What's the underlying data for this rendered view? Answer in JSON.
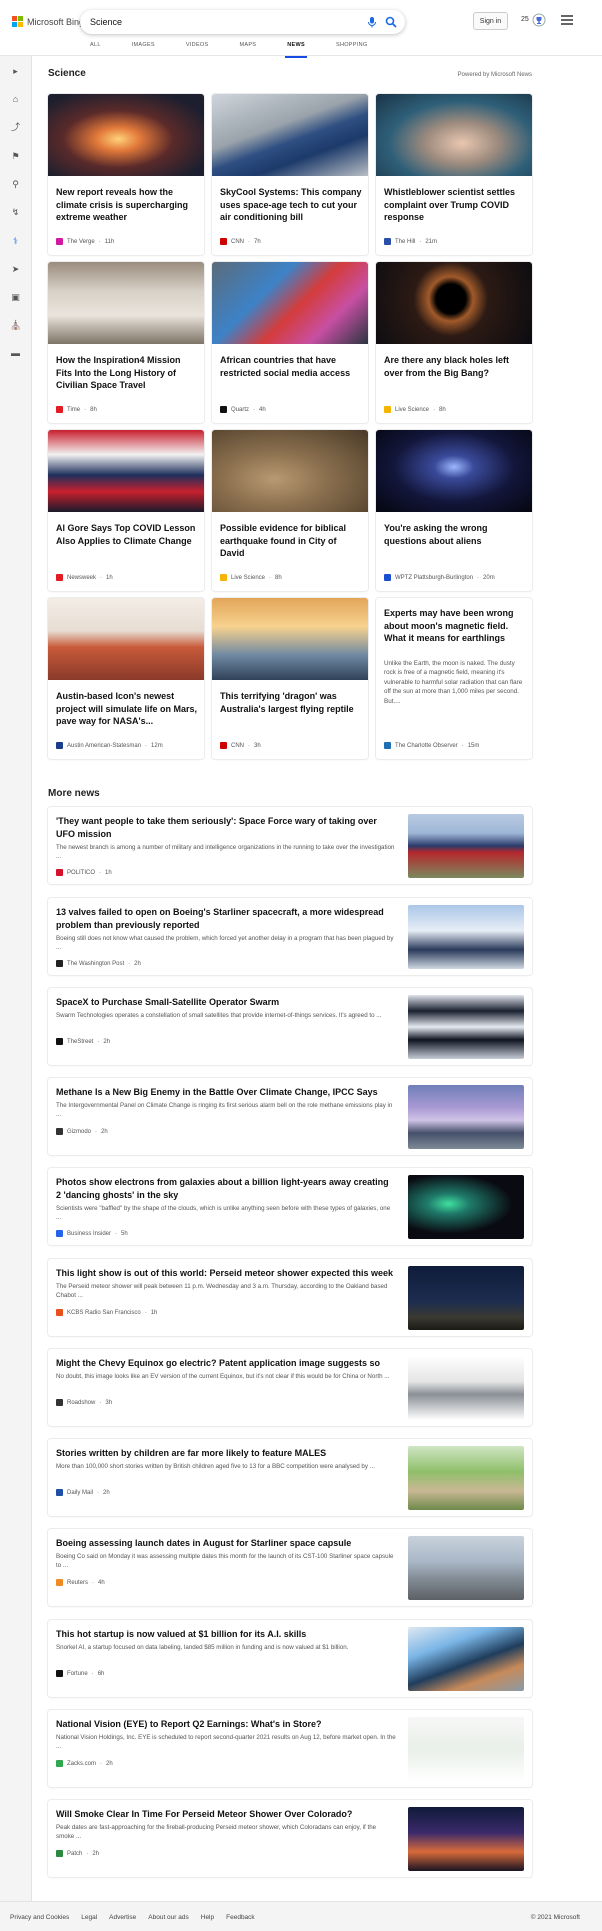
{
  "header": {
    "brand": "Microsoft Bing",
    "search_value": "Science",
    "signin": "Sign in",
    "points": "25",
    "tabs": [
      "ALL",
      "IMAGES",
      "VIDEOS",
      "MAPS",
      "NEWS",
      "SHOPPING"
    ],
    "active_tab": "NEWS"
  },
  "rail_icons": [
    "chevron-right-icon",
    "home-icon",
    "share-icon",
    "flag-icon",
    "location-icon",
    "science-icon",
    "rocket-icon",
    "film-icon",
    "bank-icon",
    "card-icon",
    "user-icon"
  ],
  "section": {
    "title": "Science",
    "powered": "Powered by Microsoft News"
  },
  "cards": [
    {
      "title": "New report reveals how the climate crisis is supercharging extreme weather",
      "source": "The Verge",
      "time": "11h",
      "fav": "#d11aa0"
    },
    {
      "title": "SkyCool Systems: This company uses space-age tech to cut your air conditioning bill",
      "source": "CNN",
      "time": "7h",
      "fav": "#cc0000"
    },
    {
      "title": "Whistleblower scientist settles complaint over Trump COVID response",
      "source": "The Hill",
      "time": "21m",
      "fav": "#2a4fa8"
    },
    {
      "title": "How the Inspiration4 Mission Fits Into the Long History of Civilian Space Travel",
      "source": "Time",
      "time": "8h",
      "fav": "#e31c23"
    },
    {
      "title": "African countries that have restricted social media access",
      "source": "Quartz",
      "time": "4h",
      "fav": "#111111"
    },
    {
      "title": "Are there any black holes left over from the Big Bang?",
      "source": "Live Science",
      "time": "8h",
      "fav": "#f4b400"
    },
    {
      "title": "Al Gore Says Top COVID Lesson Also Applies to Climate Change",
      "source": "Newsweek",
      "time": "1h",
      "fav": "#e31c23"
    },
    {
      "title": "Possible evidence for biblical earthquake found in City of David",
      "source": "Live Science",
      "time": "8h",
      "fav": "#f4b400"
    },
    {
      "title": "You're asking the wrong questions about aliens",
      "source": "WPTZ Plattsburgh-Burlington",
      "time": "20m",
      "fav": "#1a4fd1"
    },
    {
      "title": "Austin-based Icon's newest project will simulate life on Mars, pave way for NASA's...",
      "source": "Austin American-Statesman",
      "time": "12m",
      "fav": "#1a3e8c"
    },
    {
      "title": "This terrifying 'dragon' was Australia's largest flying reptile",
      "source": "CNN",
      "time": "3h",
      "fav": "#cc0000"
    },
    {
      "title": "Experts may have been wrong about moon's magnetic field. What it means for earthlings",
      "snippet": "Unlike the Earth, the moon is naked. The dusty rock is free of a magnetic field, meaning it's vulnerable to harmful solar radiation that can flare off the sun at more than 1,000 miles per second. But....",
      "source": "The Charlotte Observer",
      "time": "15m",
      "fav": "#1f6fb5"
    }
  ],
  "more_news_title": "More news",
  "more_news": [
    {
      "title": "'They want people to take them seriously': Space Force wary of taking over UFO mission",
      "snippet": "The newest branch is among a number of military and intelligence organizations in the running to take over the investigation ...",
      "source": "POLITICO",
      "time": "1h",
      "fav": "#d6112b"
    },
    {
      "title": "13 valves failed to open on Boeing's Starliner spacecraft, a more widespread problem than previously reported",
      "snippet": "Boeing still does not know what caused the problem, which forced yet another delay in a program that has been plagued by ...",
      "source": "The Washington Post",
      "time": "2h",
      "fav": "#222222"
    },
    {
      "title": "SpaceX to Purchase Small-Satellite Operator Swarm",
      "snippet": "Swarm Technologies operates a constellation of small satellites that provide internet-of-things services. It's agreed to ...",
      "source": "TheStreet",
      "time": "2h",
      "fav": "#111111"
    },
    {
      "title": "Methane Is a New Big Enemy in the Battle Over Climate Change, IPCC Says",
      "snippet": "The Intergovernmental Panel on Climate Change is ringing its first serious alarm bell on the role methane emissions play in ...",
      "source": "Gizmodo",
      "time": "2h",
      "fav": "#333333"
    },
    {
      "title": "Photos show electrons from galaxies about a billion light-years away creating 2 'dancing ghosts' in the sky",
      "snippet": "Scientists were \"baffled\" by the shape of the clouds, which is unlike anything seen before with these types of galaxies, one ...",
      "source": "Business Insider",
      "time": "5h",
      "fav": "#2563eb"
    },
    {
      "title": "This light show is out of this world: Perseid meteor shower expected this week",
      "snippet": "The Perseid meteor shower will peak between 11 p.m. Wednesday and 3 a.m. Thursday, according to the Oakland based Chabot ...",
      "source": "KCBS Radio San Francisco",
      "time": "1h",
      "fav": "#e8501c"
    },
    {
      "title": "Might the Chevy Equinox go electric? Patent application image suggests so",
      "snippet": "No doubt, this image looks like an EV version of the current Equinox, but it's not clear if this would be for China or North ...",
      "source": "Roadshow",
      "time": "3h",
      "fav": "#333333"
    },
    {
      "title": "Stories written by children are far more likely to feature MALES",
      "snippet": "More than 100,000 short stories written by British children aged five to 13 for a BBC competition were analysed by ...",
      "source": "Daily Mail",
      "time": "2h",
      "fav": "#1f4fa6"
    },
    {
      "title": "Boeing assessing launch dates in August for Starliner space capsule",
      "snippet": "Boeing Co said on Monday it was assessing multiple dates this month for the launch of its CST-100 Starliner space capsule to ...",
      "source": "Reuters",
      "time": "4h",
      "fav": "#f08a24"
    },
    {
      "title": "This hot startup is now valued at $1 billion for its A.I. skills",
      "snippet": "Snorkel AI, a startup focused on data labeling, landed $85 million in funding and is now valued at $1 billion.",
      "source": "Fortune",
      "time": "6h",
      "fav": "#111111"
    },
    {
      "title": "National Vision (EYE) to Report Q2 Earnings: What's in Store?",
      "snippet": "National Vision Holdings, Inc. EYE is scheduled to report second-quarter 2021 results on Aug 12, before market open. In the ...",
      "source": "Zacks.com",
      "time": "2h",
      "fav": "#2fa84f"
    },
    {
      "title": "Will Smoke Clear In Time For Perseid Meteor Shower Over Colorado?",
      "snippet": "Peak dates are fast-approaching for the fireball-producing Perseid meteor shower, which Coloradans can enjoy, if the smoke ...",
      "source": "Patch",
      "time": "2h",
      "fav": "#2b8a3e"
    }
  ],
  "footer": {
    "links": [
      "Privacy and Cookies",
      "Legal",
      "Advertise",
      "About our ads",
      "Help",
      "Feedback"
    ],
    "copyright": "© 2021 Microsoft"
  }
}
